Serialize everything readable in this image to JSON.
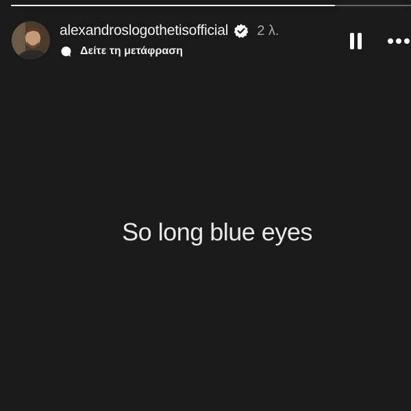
{
  "story": {
    "progress": 0.81,
    "username": "alexandroslogothetisofficial",
    "verified": true,
    "timestamp": "2 λ.",
    "translate_label": "Δείτε τη μετάφραση",
    "text": "So long blue eyes"
  },
  "controls": {
    "pause_icon": "pause-icon",
    "more_icon": "more-options-icon"
  },
  "colors": {
    "background": "#1a1a1a",
    "text": "#e8e8e8",
    "timestamp": "#a8a8a8"
  }
}
